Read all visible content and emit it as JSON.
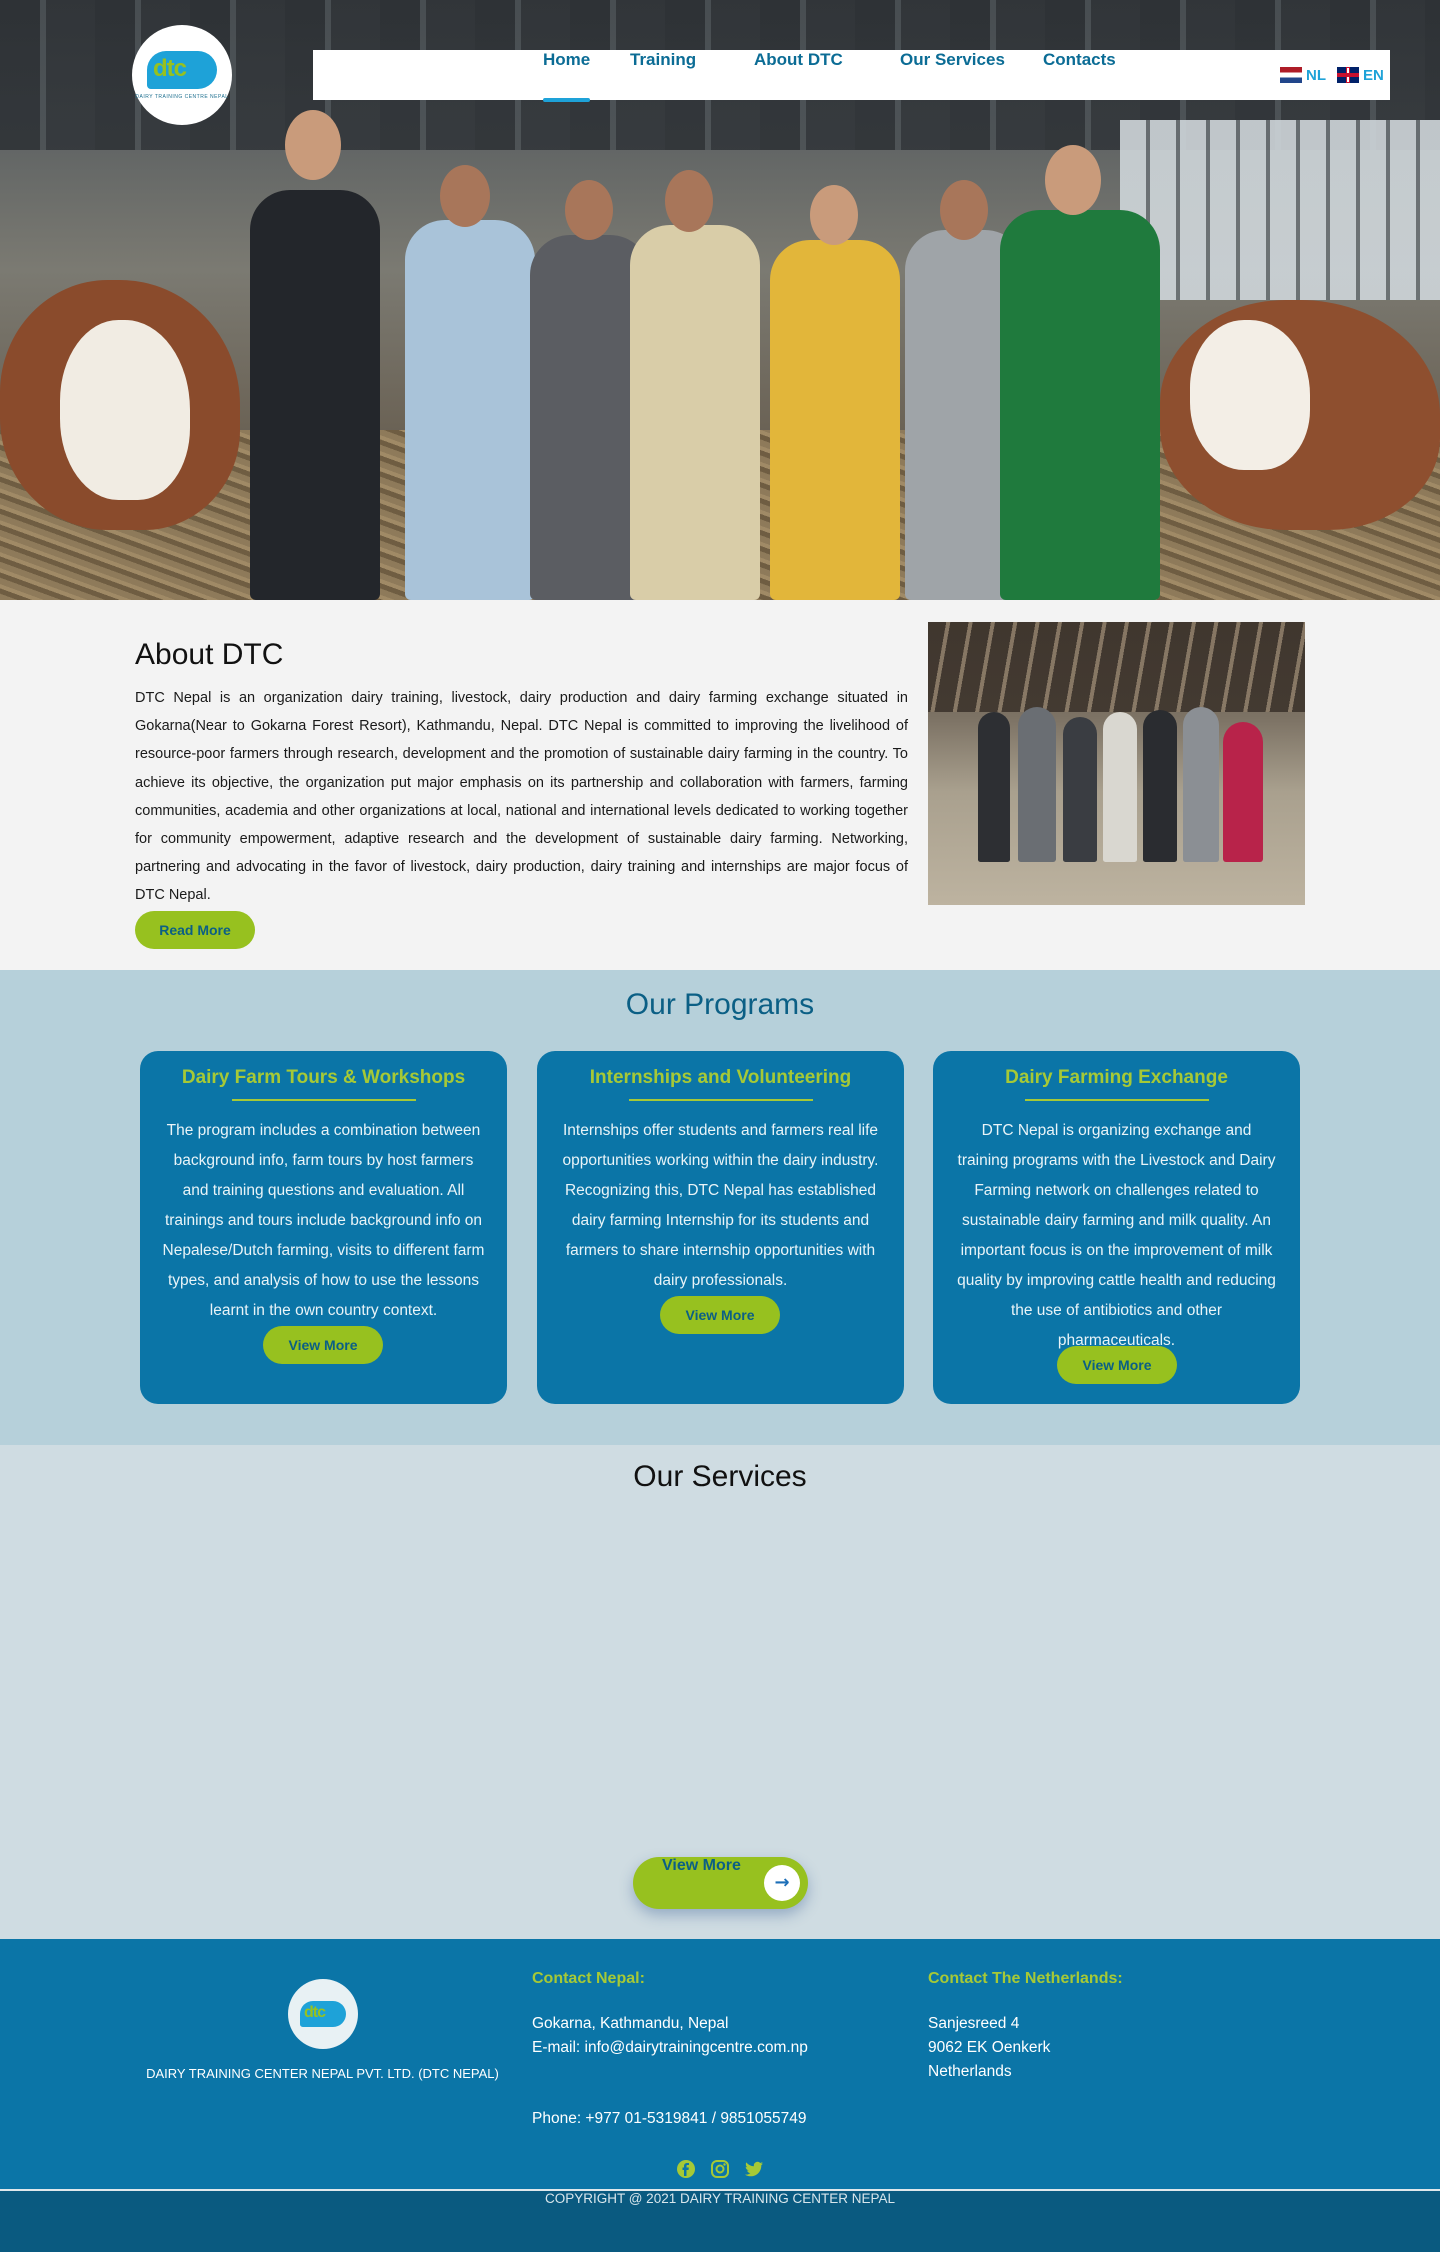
{
  "header": {
    "logo_text": "dtc",
    "logo_subtitle": "DAIRY TRAINING CENTRE NEPAL",
    "nav": [
      "Home",
      "Training",
      "About DTC",
      "Our Services",
      "Contacts"
    ],
    "active_nav": "Home",
    "languages": [
      "NL",
      "EN"
    ]
  },
  "about": {
    "title": "About DTC",
    "body": "DTC Nepal is an organization dairy training, livestock, dairy production and dairy farming exchange situated in Gokarna(Near to Gokarna Forest Resort), Kathmandu, Nepal. DTC Nepal is committed to improving the livelihood of resource-poor farmers through research, development and the promotion of sustainable dairy farming in the country. To achieve its objective, the organization put major emphasis on its partnership and collaboration with farmers, farming communities, academia and other organizations at local, national and international levels dedicated to working together for community empowerment, adaptive research and the development of sustainable dairy farming. Networking, partnering and advocating in the favor of livestock, dairy production, dairy training and internships are major focus of DTC Nepal.",
    "read_more": "Read More"
  },
  "programs": {
    "title": "Our Programs",
    "cards": [
      {
        "title": "Dairy Farm Tours & Workshops",
        "body": "The program includes a combination between background info, farm tours by host farmers and training questions and evaluation. All trainings and tours include background info on Nepalese/Dutch farming, visits to different farm types, and analysis of how to use the lessons learnt in the own country context.",
        "button": "View More"
      },
      {
        "title": "Internships and Volunteering",
        "body": "Internships offer students and farmers real life opportunities working within the dairy industry. Recognizing this, DTC Nepal has established dairy farming Internship for its students and farmers to share internship opportunities with dairy professionals.",
        "button": "View More"
      },
      {
        "title": "Dairy Farming Exchange",
        "body": "DTC Nepal is organizing exchange and training programs with the Livestock and Dairy Farming network on challenges related to sustainable dairy farming and milk quality. An important focus is on the improvement of milk quality by improving cattle health and reducing the use of antibiotics and other pharmaceuticals.",
        "button": "View More"
      }
    ]
  },
  "services": {
    "title": "Our Services",
    "button": "View More"
  },
  "footer": {
    "company": "DAIRY TRAINING CENTER NEPAL PVT. LTD. (DTC NEPAL)",
    "nepal_heading": "Contact Nepal:",
    "nepal_address": "Gokarna, Kathmandu, Nepal",
    "nepal_email": "E-mail: info@dairytrainingcentre.com.np",
    "nepal_phone": "Phone: +977 01-5319841 / 9851055749",
    "nl_heading": "Contact The Netherlands:",
    "nl_lines": [
      "Sanjesreed 4",
      "9062 EK Oenkerk",
      "Netherlands"
    ],
    "socials": [
      "facebook-icon",
      "instagram-icon",
      "twitter-icon"
    ],
    "copyright": "COPYRIGHT @ 2021 DAIRY TRAINING CENTER NEPAL"
  },
  "colors": {
    "primary_blue": "#0b75a7",
    "accent_green": "#97c11f",
    "programs_bg": "#b6d0da",
    "services_bg": "#cfdce2"
  }
}
